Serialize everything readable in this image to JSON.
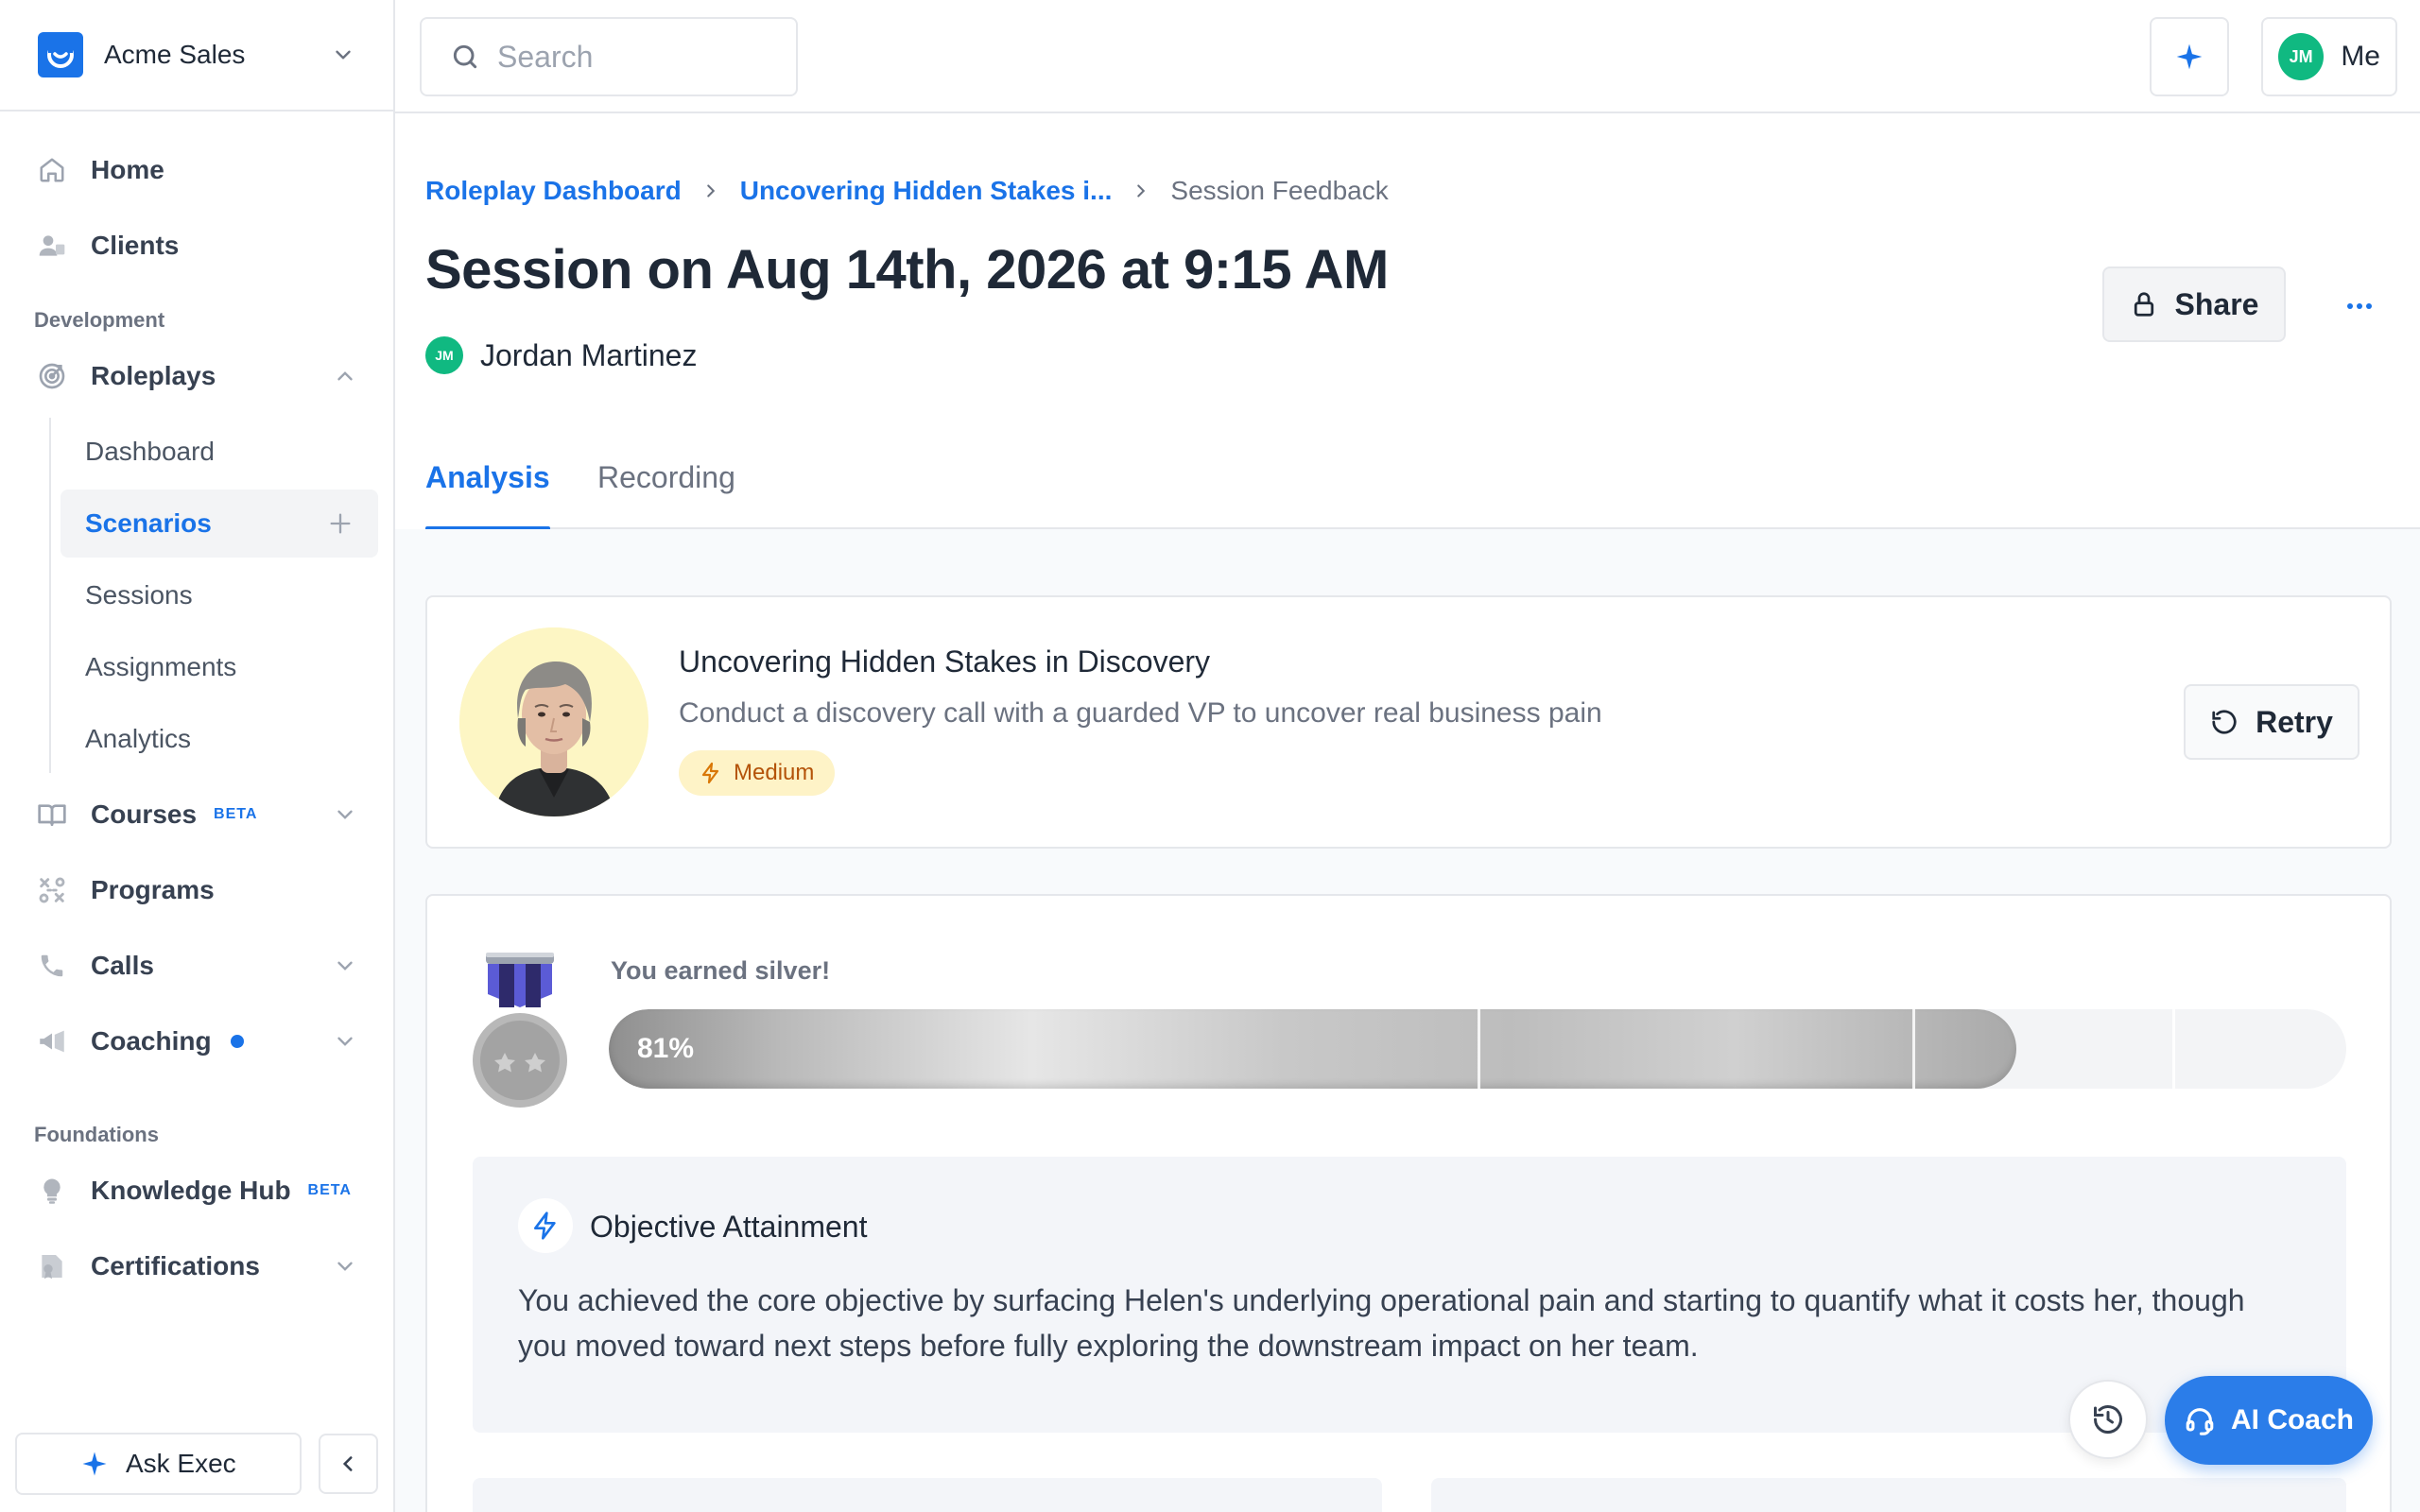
{
  "workspace": {
    "name": "Acme Sales"
  },
  "search": {
    "placeholder": "Search"
  },
  "topbar": {
    "me_label": "Me",
    "user_initials": "JM"
  },
  "sidebar": {
    "items_top": [
      {
        "label": "Home",
        "icon": "home-icon"
      },
      {
        "label": "Clients",
        "icon": "clients-icon"
      }
    ],
    "section_development": "Development",
    "roleplays": {
      "label": "Roleplays",
      "children": [
        "Dashboard",
        "Scenarios",
        "Sessions",
        "Assignments",
        "Analytics"
      ],
      "active": "Scenarios"
    },
    "courses": {
      "label": "Courses",
      "badge": "BETA"
    },
    "programs": {
      "label": "Programs"
    },
    "calls": {
      "label": "Calls"
    },
    "coaching": {
      "label": "Coaching"
    },
    "section_foundations": "Foundations",
    "knowledge_hub": {
      "label": "Knowledge Hub",
      "badge": "BETA"
    },
    "certifications": {
      "label": "Certifications"
    },
    "ask_exec": "Ask Exec"
  },
  "breadcrumb": {
    "root": "Roleplay Dashboard",
    "scenario": "Uncovering Hidden Stakes i...",
    "current": "Session Feedback"
  },
  "page": {
    "title": "Session on Aug 14th, 2026 at 9:15 AM",
    "owner_name": "Jordan Martinez",
    "owner_initials": "JM",
    "share_label": "Share"
  },
  "tabs": [
    {
      "label": "Analysis",
      "active": true
    },
    {
      "label": "Recording",
      "active": false
    }
  ],
  "scenario": {
    "title": "Uncovering Hidden Stakes in Discovery",
    "description": "Conduct a discovery call with a guarded VP to uncover real business pain",
    "difficulty": "Medium",
    "retry_label": "Retry"
  },
  "results": {
    "earned_text": "You earned silver!",
    "score_label": "81%",
    "score_fraction": 0.81,
    "tier_marks": [
      0.5,
      0.75,
      0.9
    ]
  },
  "objective": {
    "title": "Objective Attainment",
    "text": "You achieved the core objective by surfacing Helen's underlying operational pain and starting to quantify what it costs her, though you moved toward next steps before fully exploring the downstream impact on her team."
  },
  "fab": {
    "coach_label": "AI Coach"
  },
  "colors": {
    "accent": "#1a73e8",
    "avatar": "#10b981",
    "badge_bg": "#fef3c7",
    "badge_fg": "#b45309"
  }
}
